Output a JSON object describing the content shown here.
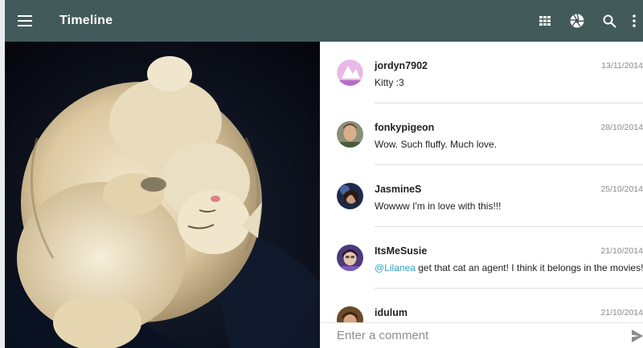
{
  "toolbar": {
    "title": "Timeline",
    "icons": [
      "menu-icon",
      "grid-icon",
      "aperture-icon",
      "search-icon",
      "more-vert-icon"
    ],
    "color": "#435a5a"
  },
  "comments": [
    {
      "user": "jordyn7902",
      "date": "13/11/2014",
      "text": "Kitty :3",
      "mention": ""
    },
    {
      "user": "fonkypigeon",
      "date": "28/10/2014",
      "text": "Wow. Such fluffy. Much love.",
      "mention": ""
    },
    {
      "user": "JasmineS",
      "date": "25/10/2014",
      "text": "Wowww I'm in love with this!!!",
      "mention": ""
    },
    {
      "user": "ItsMeSusie",
      "date": "21/10/2014",
      "text": " get that cat an agent! I think it belongs in the movies!!",
      "mention": "@Lilanea"
    },
    {
      "user": "idulum",
      "date": "21/10/2014",
      "text": "",
      "mention": ""
    }
  ],
  "comment_box": {
    "placeholder": "Enter a comment"
  },
  "colors": {
    "mention": "#2aa7c9"
  }
}
